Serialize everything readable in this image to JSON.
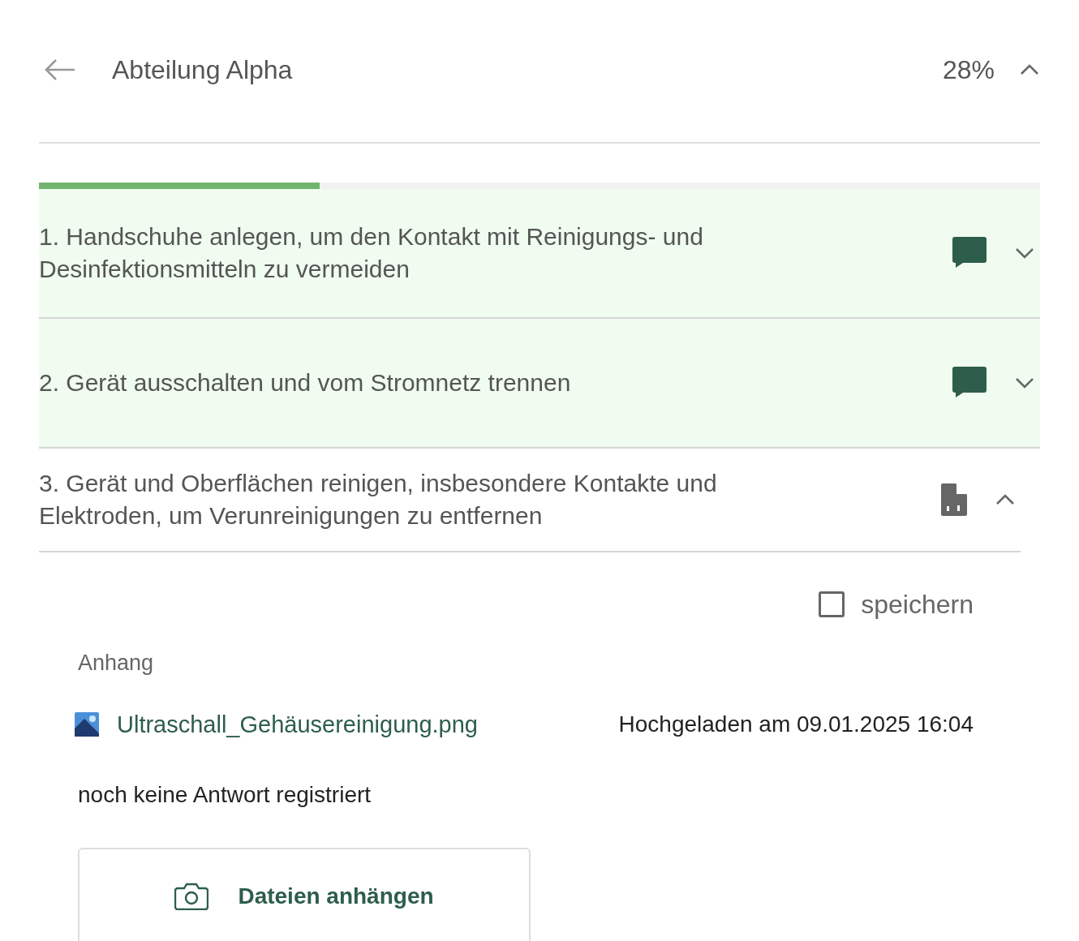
{
  "header": {
    "title": "Abteilung Alpha",
    "percent": "28%",
    "expanded": true
  },
  "progress": {
    "level": 0.28
  },
  "steps": [
    {
      "text": "1. Handschuhe anlegen, um den Kontakt mit Reinigungs- und Desinfektionsmitteln zu vermeiden",
      "done": true,
      "kind": "comment",
      "expanded": false
    },
    {
      "text": "2. Gerät ausschalten und vom Stromnetz trennen",
      "done": true,
      "kind": "comment",
      "expanded": false
    },
    {
      "text": "3. Gerät und Oberflächen reinigen, insbesondere Kontakte und Elektroden, um Verunreinigungen zu entfernen",
      "done": false,
      "kind": "file",
      "expanded": true,
      "details": {
        "save": {
          "label": "speichern",
          "checked": false
        },
        "attachment_label": "Anhang",
        "file": {
          "name": "Ultraschall_Gehäusereinigung.png",
          "uploaded": "Hochgeladen am 09.01.2025 16:04"
        },
        "answer": "noch keine Antwort registriert",
        "attach_button": "Dateien anhängen"
      }
    }
  ]
}
